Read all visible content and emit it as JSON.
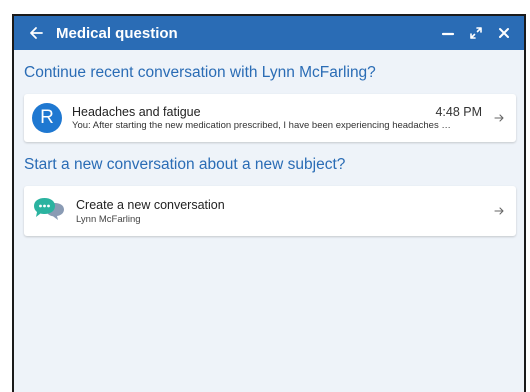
{
  "window": {
    "title": "Medical question"
  },
  "recent": {
    "heading": "Continue recent conversation with Lynn McFarling?",
    "conversation": {
      "avatar_letter": "R",
      "subject": "Headaches and fatigue",
      "time": "4:48 PM",
      "preview": "You: After starting the new medication prescribed, I have been experiencing headaches …"
    }
  },
  "new": {
    "heading": "Start a new conversation about a new subject?",
    "title": "Create a new conversation",
    "recipient": "Lynn McFarling"
  },
  "colors": {
    "titlebar": "#2a6cb5",
    "accent": "#2a6cb5",
    "avatar": "#1f78d1",
    "background": "#eef3f9"
  },
  "icons": {
    "back": "arrow-left-icon",
    "minimize": "minimize-icon",
    "expand": "expand-icon",
    "close": "close-icon",
    "open": "arrow-right-icon",
    "chat": "chat-bubbles-icon"
  }
}
